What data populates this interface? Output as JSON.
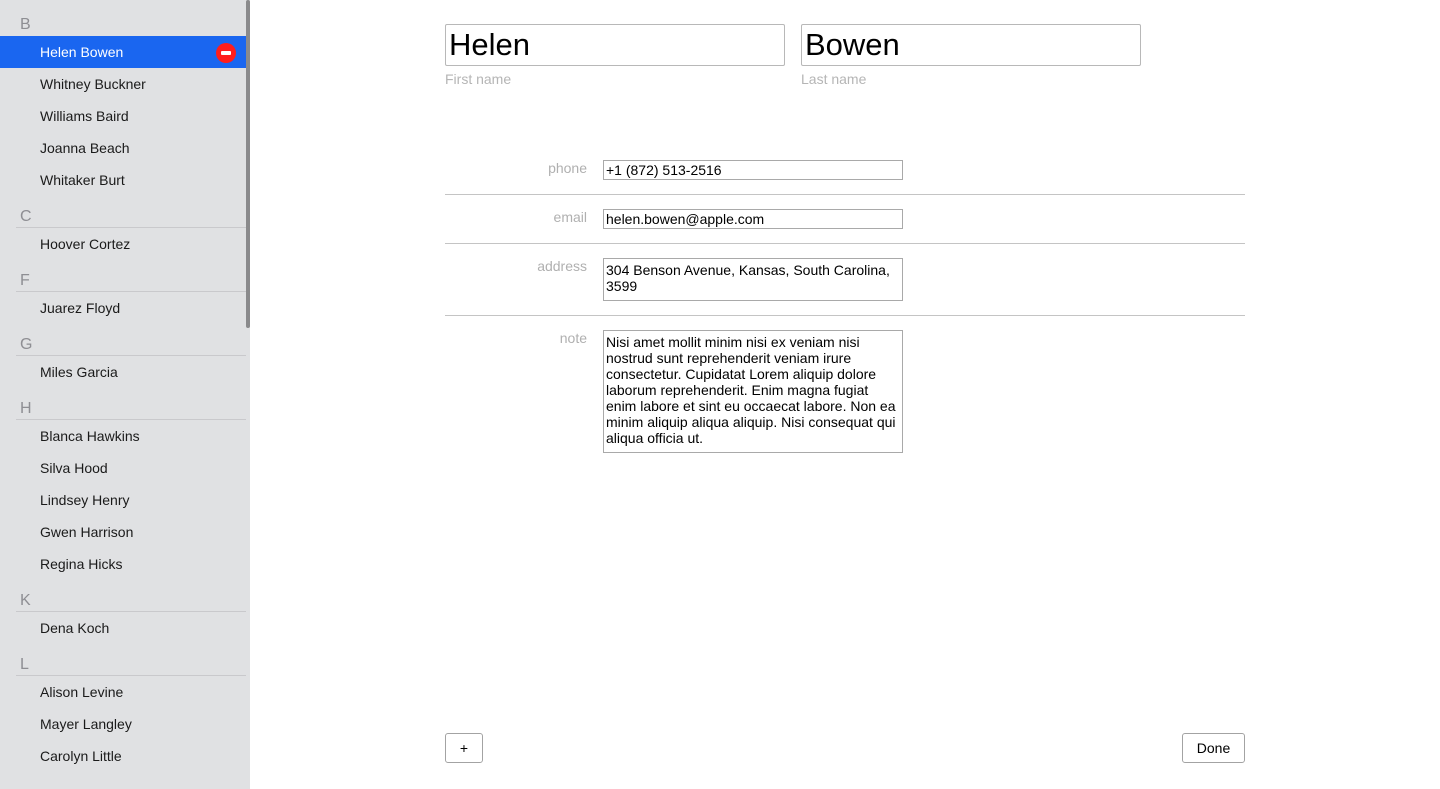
{
  "sidebar": {
    "groups": [
      {
        "letter": "B",
        "contacts": [
          "Helen Bowen",
          "Whitney Buckner",
          "Williams Baird",
          "Joanna Beach",
          "Whitaker Burt"
        ]
      },
      {
        "letter": "C",
        "contacts": [
          "Hoover Cortez"
        ]
      },
      {
        "letter": "F",
        "contacts": [
          "Juarez Floyd"
        ]
      },
      {
        "letter": "G",
        "contacts": [
          "Miles Garcia"
        ]
      },
      {
        "letter": "H",
        "contacts": [
          "Blanca Hawkins",
          "Silva Hood",
          "Lindsey Henry",
          "Gwen Harrison",
          "Regina Hicks"
        ]
      },
      {
        "letter": "K",
        "contacts": [
          "Dena Koch"
        ]
      },
      {
        "letter": "L",
        "contacts": [
          "Alison Levine",
          "Mayer Langley",
          "Carolyn Little"
        ]
      }
    ],
    "selected": "Helen Bowen"
  },
  "detail": {
    "first_name": {
      "value": "Helen",
      "caption": "First name"
    },
    "last_name": {
      "value": "Bowen",
      "caption": "Last name"
    },
    "phone": {
      "label": "phone",
      "value": "+1 (872) 513-2516"
    },
    "email": {
      "label": "email",
      "value": "helen.bowen@apple.com"
    },
    "address": {
      "label": "address",
      "value": "304 Benson Avenue, Kansas, South Carolina, 3599"
    },
    "note": {
      "label": "note",
      "value": "Nisi amet mollit minim nisi ex veniam nisi nostrud sunt reprehenderit veniam irure consectetur. Cupidatat Lorem aliquip dolore laborum reprehenderit. Enim magna fugiat enim labore et sint eu occaecat labore. Non ea minim aliquip aliqua aliquip. Nisi consequat qui aliqua officia ut."
    }
  },
  "buttons": {
    "add_label": "+",
    "done_label": "Done"
  },
  "colors": {
    "selection": "#1a66f0",
    "delete": "#ff1d1d",
    "sidebar_bg": "#e0e1e3"
  }
}
